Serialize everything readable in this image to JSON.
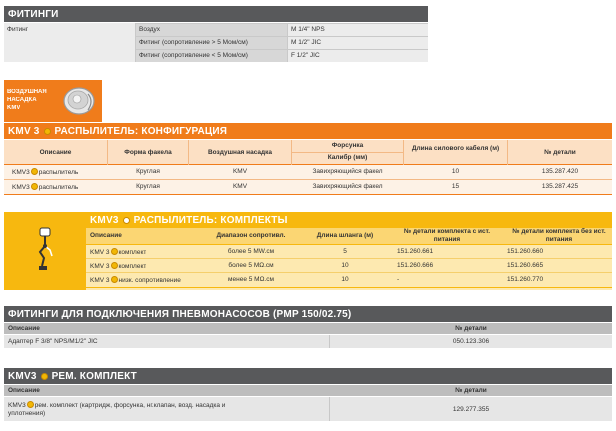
{
  "fittings": {
    "title": "ФИТИНГИ",
    "label": "Фитинг",
    "rows": [
      {
        "name": "Воздух",
        "value": "M 1/4\" NPS"
      },
      {
        "name": "Фитинг  (сопротивление > 5 Мом/см)",
        "value": "M 1/2\" JIC"
      },
      {
        "name": "Фитинг (сопротивление < 5 Мом/см)",
        "value": "F 1/2\" JIC"
      }
    ]
  },
  "air_cap": {
    "label_lines": [
      "ВОЗДУШНАЯ",
      "НАСАДКА",
      "KMV"
    ]
  },
  "config": {
    "title_prefix": "KMV 3",
    "title_suffix": "РАСПЫЛИТЕЛЬ: КОНФИГУРАЦИЯ",
    "headers": {
      "description": "Описание",
      "flame": "Форма факела",
      "air_cap": "Воздушная насадка",
      "nozzle": "Форсунка",
      "caliber": "Калибр (мм)",
      "cable": "Длина силового кабеля (м)",
      "part": "№ детали"
    },
    "rows": [
      {
        "desc_a": "KMV3",
        "desc_b": "распылитель",
        "flame": "Круглая",
        "air_cap": "KMV",
        "nozzle": "Завихряющийся факел",
        "cable": "10",
        "part": "135.287.420"
      },
      {
        "desc_a": "KMV3",
        "desc_b": "распылитель",
        "flame": "Круглая",
        "air_cap": "KMV",
        "nozzle": "Завихряющийся факел",
        "cable": "15",
        "part": "135.287.425"
      }
    ]
  },
  "kits": {
    "title_prefix": "KMV3",
    "title_suffix": "РАСПЫЛИТЕЛЬ: КОМПЛЕКТЫ",
    "headers": {
      "description": "Описание",
      "range": "Диапазон сопротивл.",
      "hose": "Длина шланга (м)",
      "with_psu": "№ детали комплекта с ист. питания",
      "without_psu": "№ детали комплекта без ист. питания"
    },
    "rows": [
      {
        "desc_a": "KMV 3",
        "desc_b": "комплект",
        "range": "более 5 MW.см",
        "hose": "5",
        "with_psu": "151.260.661",
        "without_psu": "151.260.660"
      },
      {
        "desc_a": "KMV 3",
        "desc_b": "комплект",
        "range": "более 5 MΩ.см",
        "hose": "10",
        "with_psu": "151.260.666",
        "without_psu": "151.260.665"
      },
      {
        "desc_a": "KMV 3",
        "desc_b": "низк. сопротивление",
        "range": "менее  5 MΩ.см",
        "hose": "10",
        "with_psu": "-",
        "without_psu": "151.260.770"
      }
    ]
  },
  "pump_fittings": {
    "title": "ФИТИНГИ ДЛЯ ПОДКЛЮЧЕНИЯ ПНЕВМОНАСОСОВ (PMP 150/02.75)",
    "headers": {
      "description": "Описание",
      "part": "№ детали"
    },
    "rows": [
      {
        "desc": "Адаптер F 3/8\" NPS/M1/2\" JIC",
        "part": "050.123.306"
      }
    ]
  },
  "repair": {
    "title_prefix": "KMV3",
    "title_suffix": "РЕМ. КОМПЛЕКТ",
    "headers": {
      "description": "Описание",
      "part": "№ детали"
    },
    "rows": [
      {
        "desc_a": "KMV3",
        "desc_b": "рем. комплект (картридж, форсунка, нг.клапан, возд. насадка и",
        "desc_c": "уплотнения)",
        "part": "129.277.355"
      }
    ]
  },
  "colors": {
    "gray_title": "#58595b",
    "gray_header": "#8c8c8c",
    "gray_light": "#e3e3e3",
    "orange": "#f07c1b",
    "orange_light": "#fce0c4",
    "yellow": "#f7b80f",
    "yellow_light": "#fde9b0"
  }
}
